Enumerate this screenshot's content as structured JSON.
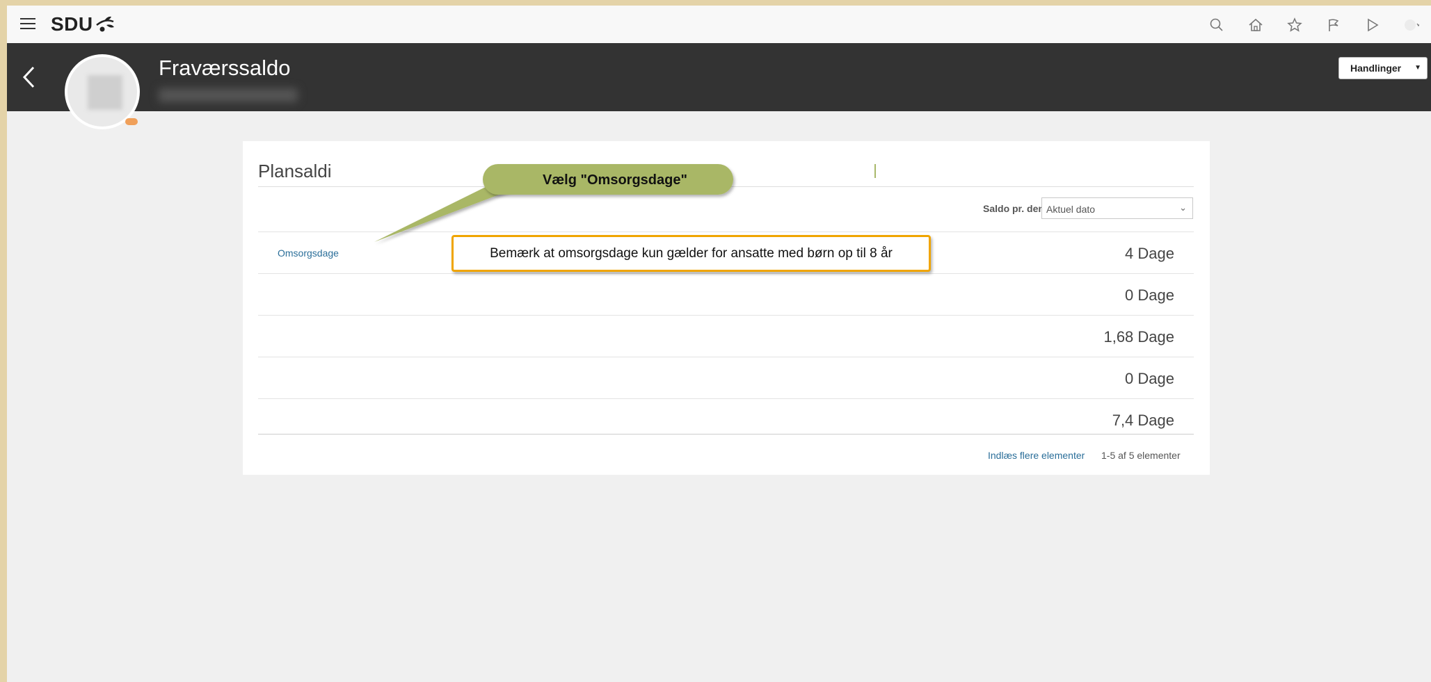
{
  "topbar": {
    "logo_text": "SDU",
    "icons": [
      "search-icon",
      "home-icon",
      "star-icon",
      "flag-icon",
      "play-icon",
      "avatar-icon"
    ]
  },
  "header": {
    "title": "Fraværssaldo",
    "actions_label": "Handlinger"
  },
  "card": {
    "title": "Plansaldi",
    "date_label": "Saldo pr. den",
    "date_value": "Aktuel dato",
    "rows": [
      {
        "label": "Omsorgsdage",
        "value": "4 Dage"
      },
      {
        "label": "",
        "value": "0 Dage"
      },
      {
        "label": "",
        "value": "1,68 Dage"
      },
      {
        "label": "",
        "value": "0 Dage"
      },
      {
        "label": "",
        "value": "7,4 Dage"
      }
    ],
    "load_more": "Indlæs flere elementer",
    "count_text": "1-5 af 5 elementer"
  },
  "callouts": {
    "green": "Vælg \"Omsorgsdage\"",
    "orange": "Bemærk at omsorgsdage kun gælder for ansatte med børn op til 8 år"
  },
  "colors": {
    "header_bg": "#333333",
    "link": "#2a6e99",
    "callout_green": "#a9b766",
    "callout_orange": "#f0a500"
  }
}
